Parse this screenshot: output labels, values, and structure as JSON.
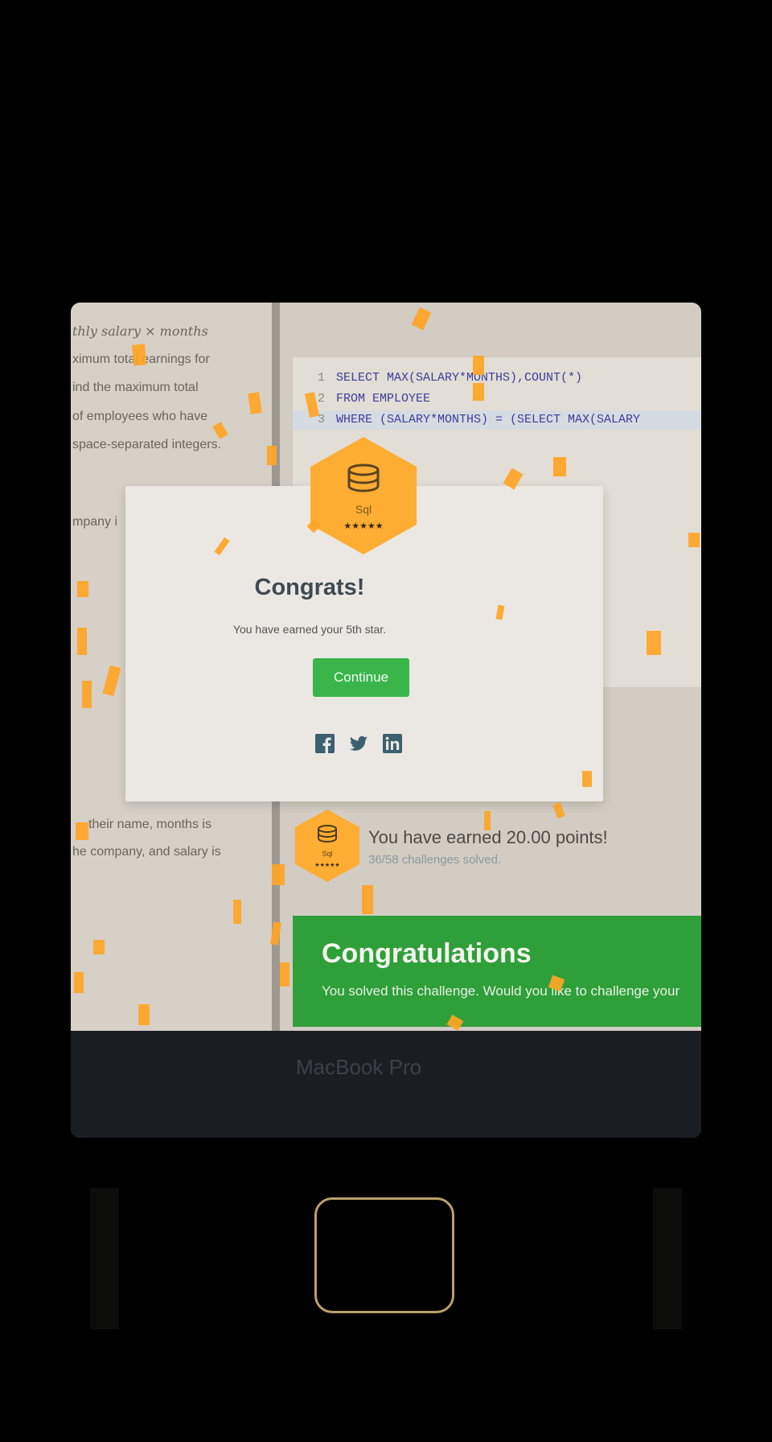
{
  "problem_description": {
    "lines": [
      "thly salary × months",
      "ximum total earnings for",
      "ind the maximum total",
      "of employees who have",
      "space-separated integers.",
      "mpany i",
      "their name, months is",
      "he company, and salary is"
    ]
  },
  "editor": {
    "lines": [
      {
        "num": "1",
        "code": "SELECT MAX(SALARY*MONTHS),COUNT(*)"
      },
      {
        "num": "2",
        "code": "FROM EMPLOYEE"
      },
      {
        "num": "3",
        "code": "WHERE (SALARY*MONTHS) = (SELECT MAX(SALARY"
      }
    ]
  },
  "modal": {
    "badge_label": "Sql",
    "badge_stars": "★★★★★",
    "title": "Congrats!",
    "message": "You have earned your 5th star.",
    "continue_label": "Continue",
    "share_icons": [
      "facebook-icon",
      "twitter-icon",
      "linkedin-icon"
    ]
  },
  "points": {
    "badge_label": "Sql",
    "badge_stars": "★★★★★",
    "text": "You have earned 20.00 points!",
    "sub": "36/58 challenges solved."
  },
  "banner": {
    "title": "Congratulations",
    "text": "You solved this challenge. Would you like to challenge your"
  },
  "bezel": {
    "label": "MacBook Pro"
  },
  "colors": {
    "badge_orange": "#ffad33",
    "success_green": "#39b54a",
    "confetti": "#ffa425"
  }
}
